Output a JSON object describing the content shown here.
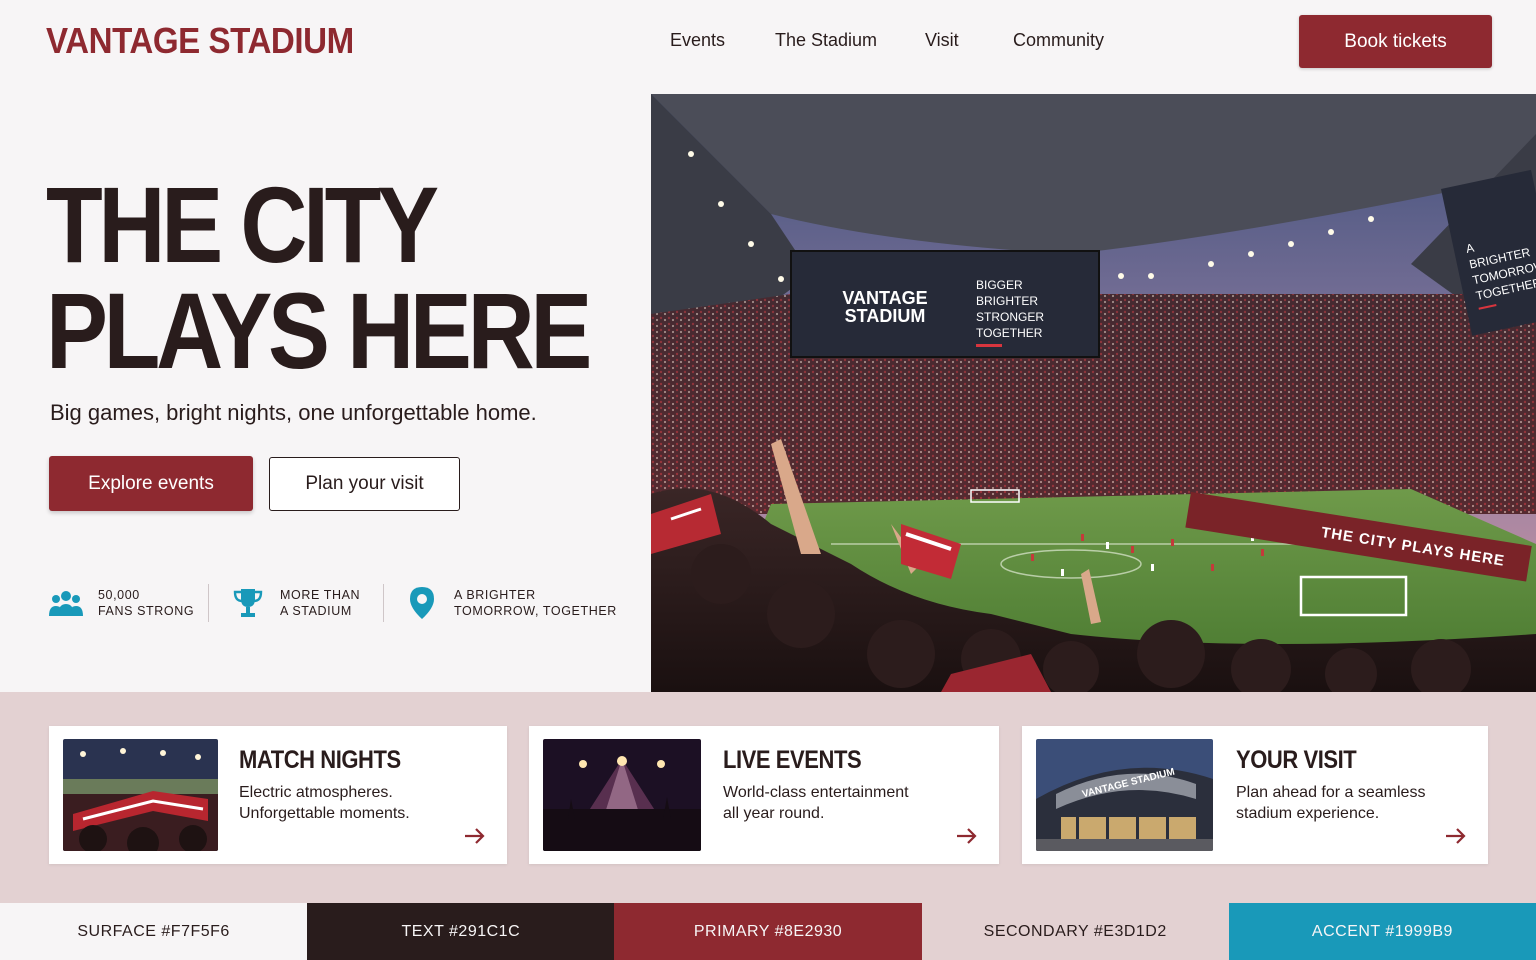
{
  "brand": {
    "logo": "VANTAGE STADIUM"
  },
  "nav": {
    "items": [
      "Events",
      "The Stadium",
      "Visit",
      "Community"
    ],
    "cta": "Book tickets"
  },
  "hero": {
    "title_line1": "THE CITY",
    "title_line2": "PLAYS HERE",
    "subtitle": "Big games, bright nights, one unforgettable home.",
    "primary_button": "Explore events",
    "secondary_button": "Plan your visit",
    "image_alt_icon": "stadium-crowd-photo",
    "screen_brand_line1": "VANTAGE",
    "screen_brand_line2": "STADIUM",
    "screen_tagline": [
      "BIGGER",
      "BRIGHTER",
      "STRONGER",
      "TOGETHER"
    ],
    "side_banner": [
      "A",
      "BRIGHTER",
      "TOMORROW",
      "TOGETHER"
    ],
    "ribbon_text": "THE CITY PLAYS HERE"
  },
  "stats": [
    {
      "icon": "people-icon",
      "line1": "50,000",
      "line2": "FANS STRONG"
    },
    {
      "icon": "trophy-icon",
      "line1": "MORE THAN",
      "line2": "A STADIUM"
    },
    {
      "icon": "location-pin-icon",
      "line1": "A BRIGHTER",
      "line2": "TOMORROW, TOGETHER"
    }
  ],
  "cards": [
    {
      "title": "MATCH NIGHTS",
      "desc_line1": "Electric atmospheres.",
      "desc_line2": "Unforgettable moments.",
      "icon": "arrow-right-icon"
    },
    {
      "title": "LIVE EVENTS",
      "desc_line1": "World-class entertainment",
      "desc_line2": "all year round.",
      "icon": "arrow-right-icon"
    },
    {
      "title": "YOUR VISIT",
      "desc_line1": "Plan ahead for a seamless",
      "desc_line2": "stadium experience.",
      "icon": "arrow-right-icon",
      "building_sign": "VANTAGE STADIUM"
    }
  ],
  "palette": [
    {
      "label": "SURFACE #F7F5F6",
      "color": "#F7F5F6",
      "text_color": "#291C1C"
    },
    {
      "label": "TEXT #291C1C",
      "color": "#291C1C",
      "text_color": "#F7F5F6"
    },
    {
      "label": "PRIMARY #8E2930",
      "color": "#8E2930",
      "text_color": "#F7F5F6"
    },
    {
      "label": "SECONDARY #E3D1D2",
      "color": "#E3D1D2",
      "text_color": "#291C1C"
    },
    {
      "label": "ACCENT #1999B9",
      "color": "#1999B9",
      "text_color": "#F7F5F6"
    }
  ]
}
